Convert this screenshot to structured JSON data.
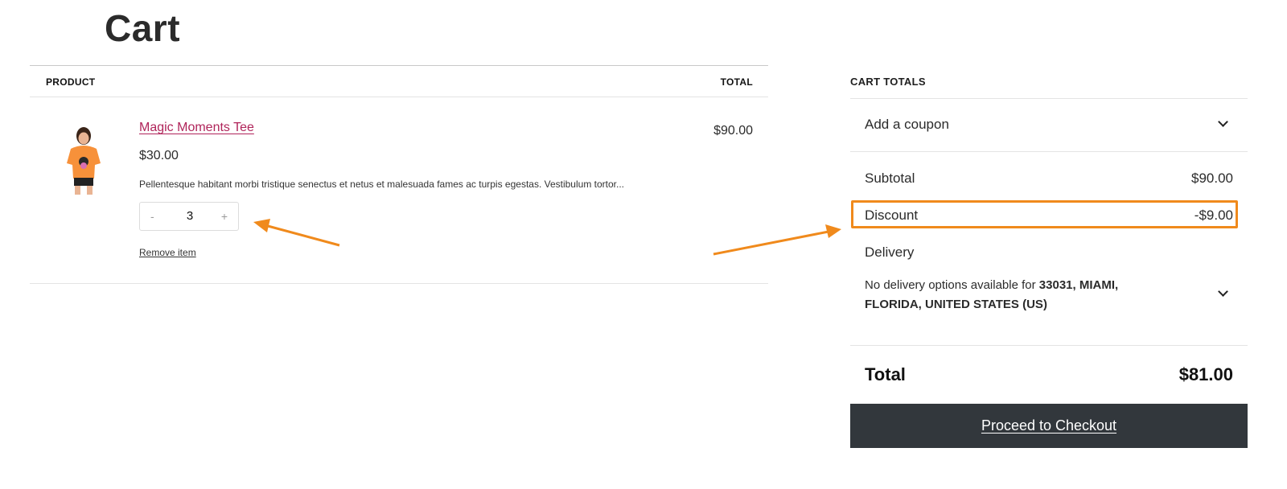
{
  "page": {
    "title": "Cart"
  },
  "cart_table": {
    "headers": {
      "product": "PRODUCT",
      "total": "TOTAL"
    },
    "items": [
      {
        "name": "Magic Moments Tee",
        "price": "$30.00",
        "description": "Pellentesque habitant morbi tristique senectus et netus et malesuada fames ac turpis egestas. Vestibulum tortor...",
        "quantity": "3",
        "minus_label": "-",
        "plus_label": "+",
        "remove_label": "Remove item",
        "line_total": "$90.00"
      }
    ]
  },
  "cart_totals": {
    "title": "CART TOTALS",
    "coupon_label": "Add a coupon",
    "subtotal_label": "Subtotal",
    "subtotal_value": "$90.00",
    "discount_label": "Discount",
    "discount_value": "-$9.00",
    "delivery_label": "Delivery",
    "delivery_text": "No delivery options available for",
    "delivery_location": "33031, MIAMI, FLORIDA, UNITED STATES (US)",
    "total_label": "Total",
    "total_value": "$81.00",
    "checkout_label": "Proceed to Checkout"
  },
  "colors": {
    "accent_link": "#b0245a",
    "highlight": "#f08a1c",
    "checkout_bg": "#32373c"
  }
}
